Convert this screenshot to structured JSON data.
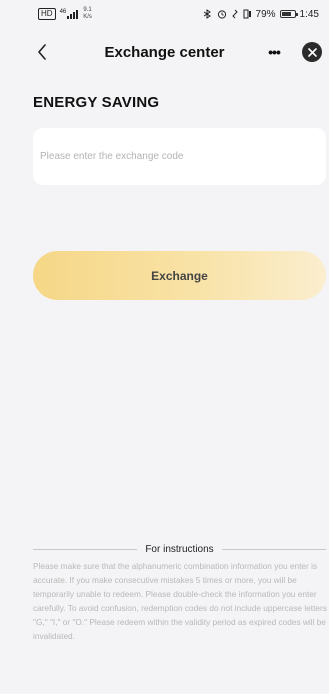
{
  "status_bar": {
    "sim": "HD",
    "signal": "46",
    "speed_value": "9.1",
    "speed_unit": "K/s",
    "battery": "79%",
    "time": "1:45",
    "battery_level": 0.79
  },
  "header": {
    "title": "Exchange center",
    "more_label": "•••"
  },
  "section_title": "ENERGY SAVING",
  "code_input": {
    "placeholder": "Please enter the exchange code",
    "value": ""
  },
  "exchange_button": {
    "label": "Exchange"
  },
  "instructions": {
    "title": "For instructions",
    "text": "Please make sure that the alphanumeric combination information you enter is accurate. If you make consecutive mistakes 5 times or more, you will be temporarily unable to redeem. Please double-check the information you enter carefully. To avoid confusion, redemption codes do not include uppercase letters \"G,\" \"I,\" or \"O.\" Please redeem within the validity period as expired codes will be invalidated."
  },
  "colors": {
    "background": "#f4f4f6",
    "card": "#ffffff",
    "button_gradient_start": "#f6d787",
    "button_gradient_end": "#fbeecf",
    "close_button": "#2b2b2b",
    "muted_text": "#b8b8b8"
  },
  "icons": {
    "back": "chevron-left-icon",
    "more": "more-dots-icon",
    "close": "close-icon",
    "signal": "signal-icon",
    "battery": "battery-icon",
    "alarm": "alarm-icon",
    "bluetooth": "bluetooth-icon",
    "vibrate": "vibrate-icon"
  }
}
